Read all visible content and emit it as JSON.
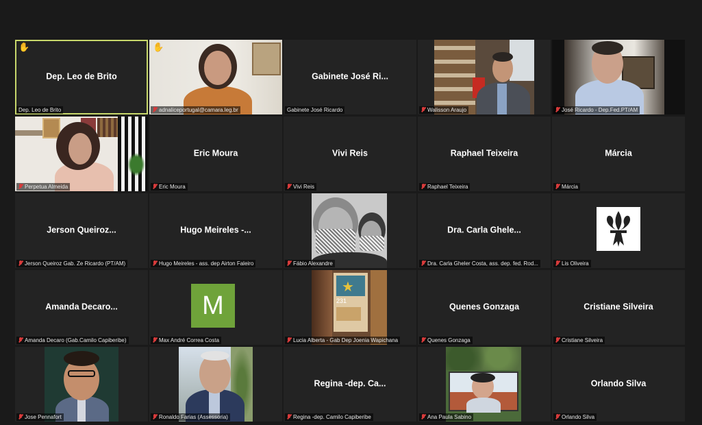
{
  "participants": [
    {
      "label": "Dep. Leo de Brito",
      "center": "Dep. Leo de Brito",
      "hand": true
    },
    {
      "label": "adnaliceportugal@camara.leg.br",
      "hand": true
    },
    {
      "label": "Gabinete José Ricardo",
      "center": "Gabinete José Ri..."
    },
    {
      "label": "Walisson Araujo"
    },
    {
      "label": "José Ricardo - Dep.Fed.PT/AM"
    },
    {
      "label": "Perpetua Almeida"
    },
    {
      "label": "Eric Moura",
      "center": "Eric Moura"
    },
    {
      "label": "Vivi Reis",
      "center": "Vivi Reis"
    },
    {
      "label": "Raphael Teixeira",
      "center": "Raphael Teixeira"
    },
    {
      "label": "Márcia",
      "center": "Márcia"
    },
    {
      "label": "Jerson Queiroz Gab. Ze Ricardo  (PT/AM)",
      "center": "Jerson  Queiroz..."
    },
    {
      "label": "Hugo Meireles - ass. dep Airton Faleiro",
      "center": "Hugo Meireles -..."
    },
    {
      "label": "Fábio Alexandre"
    },
    {
      "label": "Dra. Carla Gheler Costa, ass. dep.  fed. Rod...",
      "center": "Dra. Carla Ghele..."
    },
    {
      "label": "Lis Oliveira"
    },
    {
      "label": "Amanda Decaro (Gab.Camilo Capiberibe)",
      "center": "Amanda  Decaro..."
    },
    {
      "label": "Max André Correa Costa",
      "avatar_letter": "M"
    },
    {
      "label": "Lucia Alberta - Gab Dep Joenia Wapichana",
      "poster_text": "231"
    },
    {
      "label": "Quenes Gonzaga",
      "center": "Quenes Gonzaga"
    },
    {
      "label": "Cristiane Silveira",
      "center": "Cristiane Silveira"
    },
    {
      "label": "Jose Pennafort"
    },
    {
      "label": "Ronaldo Farias (Assessoria)"
    },
    {
      "label": "Regina -dep. Camilo Capiberibe",
      "center": "Regina -dep. Ca..."
    },
    {
      "label": "Ana Paula Sabino"
    },
    {
      "label": "Orlando Silva",
      "center": "Orlando Silva"
    }
  ],
  "colors": {
    "active_border": "#c8d86b",
    "mic_muted": "#d83b3b",
    "hand": "#f2b33a",
    "avatar_m": "#6fa33a"
  },
  "icons": {
    "hand": "raised-hand-icon",
    "mic": "mic-muted-icon"
  }
}
